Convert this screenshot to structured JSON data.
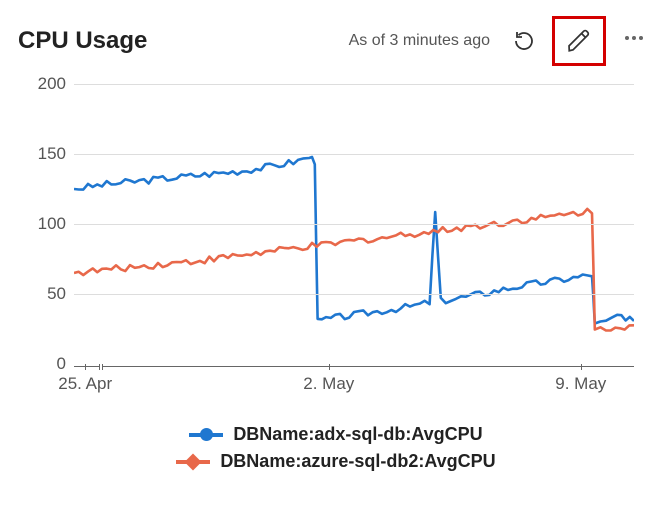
{
  "header": {
    "title": "CPU Usage",
    "status": "As of 3 minutes ago"
  },
  "colors": {
    "series1": "#1f77d0",
    "series2": "#e8684a"
  },
  "legend": {
    "s1": "DBName:adx-sql-db:AvgCPU",
    "s2": "DBName:azure-sql-db2:AvgCPU"
  },
  "axes": {
    "y": {
      "ticks": [
        0,
        50,
        100,
        150,
        200
      ]
    },
    "x": {
      "ticks": [
        {
          "pos": 0.02,
          "label": "25. Apr"
        },
        {
          "pos": 0.455,
          "label": "2. May"
        },
        {
          "pos": 0.905,
          "label": "9. May"
        }
      ]
    }
  },
  "chart_data": {
    "type": "line",
    "title": "CPU Usage",
    "xlabel": "",
    "ylabel": "",
    "ylim": [
      0,
      200
    ],
    "x_range": [
      "25. Apr",
      "10. May"
    ],
    "x_ticks": [
      "25. Apr",
      "2. May",
      "9. May"
    ],
    "series": [
      {
        "name": "DBName:adx-sql-db:AvgCPU",
        "color": "#1f77d0",
        "points": [
          [
            0.0,
            125
          ],
          [
            0.05,
            128
          ],
          [
            0.1,
            130
          ],
          [
            0.15,
            132
          ],
          [
            0.2,
            134
          ],
          [
            0.25,
            136
          ],
          [
            0.3,
            138
          ],
          [
            0.35,
            141
          ],
          [
            0.4,
            145
          ],
          [
            0.42,
            148
          ],
          [
            0.43,
            145
          ],
          [
            0.435,
            30
          ],
          [
            0.45,
            32
          ],
          [
            0.5,
            35
          ],
          [
            0.55,
            38
          ],
          [
            0.6,
            41
          ],
          [
            0.635,
            44
          ],
          [
            0.645,
            108
          ],
          [
            0.655,
            45
          ],
          [
            0.7,
            48
          ],
          [
            0.75,
            52
          ],
          [
            0.8,
            56
          ],
          [
            0.85,
            59
          ],
          [
            0.9,
            62
          ],
          [
            0.925,
            64
          ],
          [
            0.93,
            28
          ],
          [
            0.95,
            30
          ],
          [
            0.97,
            35
          ],
          [
            0.985,
            30
          ],
          [
            1.0,
            33
          ]
        ]
      },
      {
        "name": "DBName:azure-sql-db2:AvgCPU",
        "color": "#e8684a",
        "points": [
          [
            0.0,
            65
          ],
          [
            0.05,
            67
          ],
          [
            0.1,
            69
          ],
          [
            0.15,
            71
          ],
          [
            0.2,
            73
          ],
          [
            0.25,
            75
          ],
          [
            0.3,
            78
          ],
          [
            0.35,
            80
          ],
          [
            0.4,
            83
          ],
          [
            0.45,
            85
          ],
          [
            0.5,
            88
          ],
          [
            0.55,
            90
          ],
          [
            0.6,
            93
          ],
          [
            0.65,
            95
          ],
          [
            0.7,
            98
          ],
          [
            0.75,
            100
          ],
          [
            0.8,
            103
          ],
          [
            0.85,
            105
          ],
          [
            0.9,
            108
          ],
          [
            0.925,
            110
          ],
          [
            0.93,
            25
          ],
          [
            0.95,
            26
          ],
          [
            0.975,
            27
          ],
          [
            1.0,
            27
          ]
        ]
      }
    ]
  }
}
